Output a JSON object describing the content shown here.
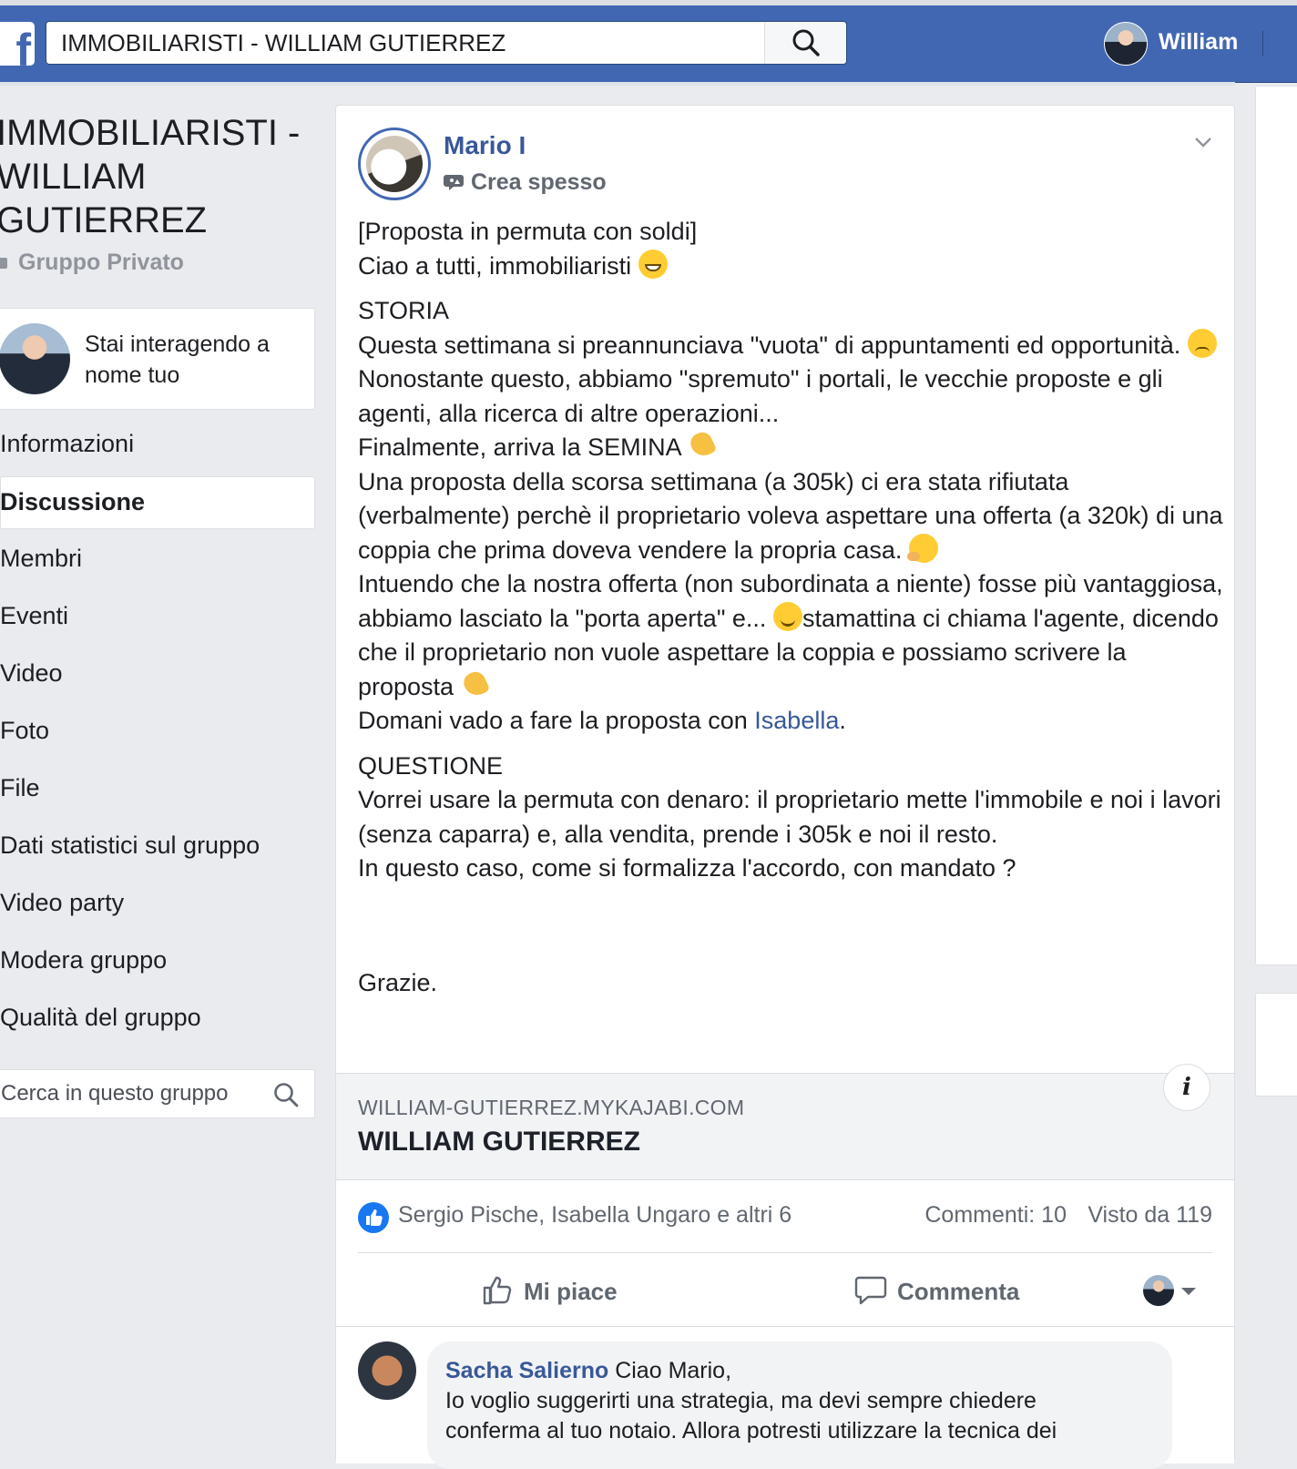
{
  "topbar": {
    "logo_letter": "f",
    "search_value": "IMMOBILIARISTI - WILLIAM GUTIERREZ",
    "user_name": "William"
  },
  "group": {
    "title": "IMMOBILIARISTI - WILLIAM GUTIERREZ",
    "privacy": "Gruppo Privato",
    "acting_as": "Stai interagendo a nome tuo",
    "nav": [
      {
        "label": "Informazioni"
      },
      {
        "label": "Discussione",
        "active": true
      },
      {
        "label": "Membri"
      },
      {
        "label": "Eventi"
      },
      {
        "label": "Video"
      },
      {
        "label": "Foto"
      },
      {
        "label": "File"
      },
      {
        "label": "Dati statistici sul gruppo"
      },
      {
        "label": "Video party"
      },
      {
        "label": "Modera gruppo"
      },
      {
        "label": "Qualità del gruppo"
      }
    ],
    "search_placeholder": "Cerca in questo gruppo"
  },
  "post": {
    "author": "Mario I",
    "badge": "Crea spesso",
    "line_intro_1": "[Proposta in permuta con soldi]",
    "line_intro_2": "Ciao a tutti, immobiliaristi",
    "storia_heading": "STORIA",
    "storia_1": "Questa settimana si preannunciava \"vuota\" di appuntamenti ed opportunità.",
    "storia_2": "Nonostante questo, abbiamo \"spremuto\" i portali, le vecchie proposte e gli agenti, alla ricerca di altre operazioni...",
    "storia_3": "Finalmente, arriva la SEMINA",
    "storia_4": "Una proposta della scorsa settimana (a 305k) ci era stata rifiutata (verbalmente) perchè il proprietario voleva aspettare una offerta (a 320k) di una coppia che prima doveva vendere la propria casa.",
    "storia_5a": "Intuendo che la nostra offerta (non subordinata a niente) fosse più vantaggiosa, abbiamo lasciato la \"porta aperta\" e...",
    "storia_5b": "stamattina ci chiama l'agente, dicendo che il proprietario non vuole aspettare la coppia e possiamo scrivere la proposta",
    "storia_6_pre": "Domani vado a fare la proposta con",
    "storia_6_mention": "Isabella",
    "storia_6_post": ".",
    "questione_heading": "QUESTIONE",
    "questione_1": "Vorrei usare la permuta con denaro: il proprietario mette l'immobile e noi i lavori (senza caparra) e, alla vendita, prende i 305k e noi il resto.",
    "questione_2": "In questo caso, come si formalizza l'accordo, con mandato ?",
    "closing": "Grazie.",
    "link_domain": "WILLIAM-GUTIERREZ.MYKAJABI.COM",
    "link_title": "WILLIAM GUTIERREZ",
    "info_glyph": "i",
    "reactors": "Sergio Pische, Isabella Ungaro e altri 6",
    "comments_count": "Commenti: 10",
    "views_count": "Visto da 119",
    "like_label": "Mi piace",
    "comment_label": "Commenta"
  },
  "comment": {
    "author": "Sacha Salierno",
    "text_line_1": "Ciao Mario,",
    "text_line_2": "Io voglio suggerirti una strategia, ma devi sempre chiedere",
    "text_line_3": "conferma al tuo notaio. Allora potresti utilizzare la tecnica dei"
  },
  "colors": {
    "brand": "#4267b2",
    "link": "#385898",
    "like_blue": "#1877f2"
  },
  "icons": [
    "facebook-logo",
    "search-icon",
    "lock-icon",
    "chevron-down-icon",
    "artist-badge-icon",
    "info-icon",
    "like-reaction-icon",
    "thumbs-up-icon",
    "comment-icon",
    "caret-down-icon"
  ]
}
